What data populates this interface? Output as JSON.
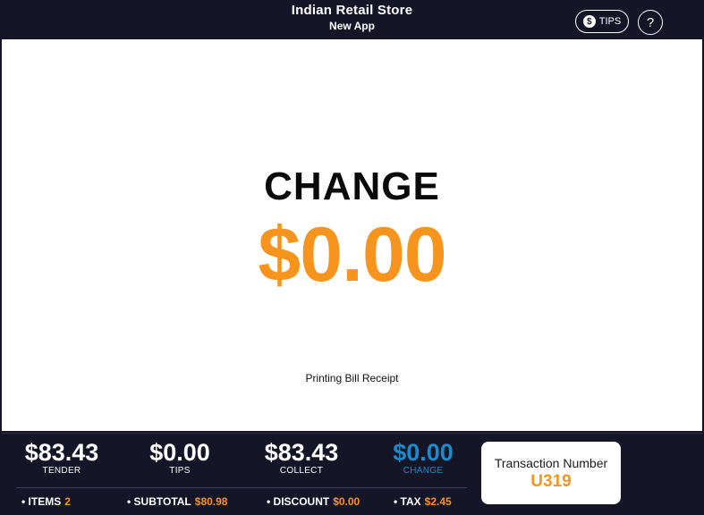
{
  "header": {
    "store_name": "Indian Retail Store",
    "app_name": "New App",
    "tips_label": "TIPS",
    "tips_icon": "$",
    "help_label": "?"
  },
  "main": {
    "change_label": "CHANGE",
    "change_amount": "$0.00",
    "status_text": "Printing Bill Receipt"
  },
  "footer": {
    "stats": [
      {
        "value": "$83.43",
        "label": "TENDER"
      },
      {
        "value": "$0.00",
        "label": "TIPS"
      },
      {
        "value": "$83.43",
        "label": "COLLECT"
      },
      {
        "value": "$0.00",
        "label": "CHANGE"
      }
    ],
    "summary": [
      {
        "label": "• ITEMS",
        "value": "2"
      },
      {
        "label": "• SUBTOTAL",
        "value": "$80.98"
      },
      {
        "label": "• DISCOUNT",
        "value": "$0.00"
      },
      {
        "label": "• TAX",
        "value": "$2.45"
      }
    ],
    "transaction": {
      "title": "Transaction Number",
      "number": "U319"
    }
  },
  "colors": {
    "background": "#141527",
    "accent_orange": "#f7941d",
    "accent_blue": "#1f8ac9"
  }
}
